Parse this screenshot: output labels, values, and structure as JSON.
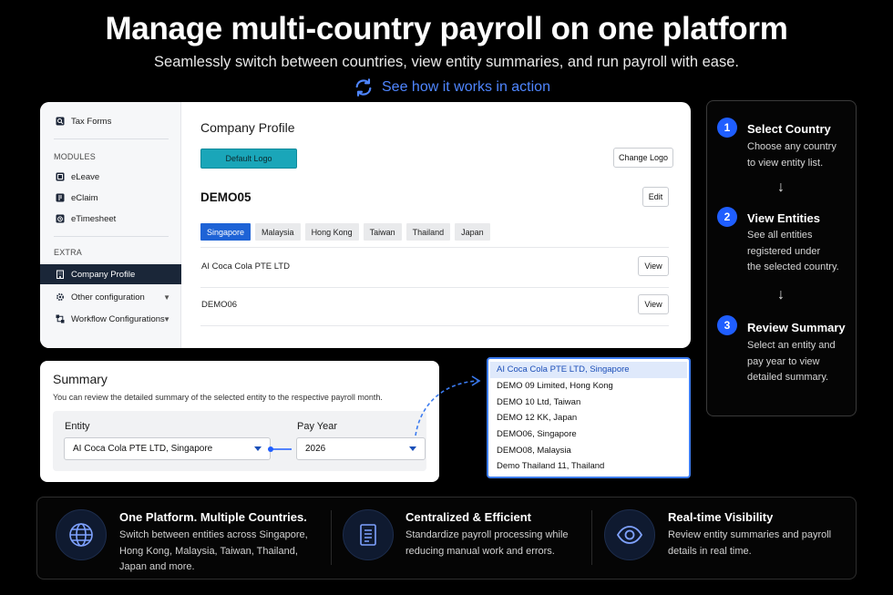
{
  "hero": {
    "title": "Manage multi-country payroll on one platform",
    "subtitle": "Seamlessly switch between countries, view entity summaries, and run payroll with ease.",
    "link_label": "See how it works in action"
  },
  "sidebar": {
    "top_item": "Tax Forms",
    "modules_header": "MODULES",
    "modules": [
      "eLeave",
      "eClaim",
      "eTimesheet"
    ],
    "extra_header": "EXTRA",
    "extra": [
      "Company Profile",
      "Other configuration",
      "Workflow Configurations"
    ],
    "active": "Company Profile"
  },
  "company_profile": {
    "title": "Company Profile",
    "default_logo_label": "Default Logo",
    "change_logo_label": "Change Logo",
    "entity_name": "DEMO05",
    "edit_label": "Edit",
    "tabs": [
      "Singapore",
      "Malaysia",
      "Hong Kong",
      "Taiwan",
      "Thailand",
      "Japan"
    ],
    "active_tab": "Singapore",
    "rows": [
      {
        "name": "AI Coca Cola PTE LTD",
        "action": "View"
      },
      {
        "name": "DEMO06",
        "action": "View"
      }
    ]
  },
  "summary": {
    "title": "Summary",
    "description": "You can review the detailed summary of the selected entity to the respective payroll month.",
    "entity_label": "Entity",
    "entity_value": "AI Coca Cola PTE LTD, Singapore",
    "year_label": "Pay Year",
    "year_value": "2026"
  },
  "entity_dropdown": {
    "options": [
      "AI Coca Cola PTE LTD, Singapore",
      "DEMO 09 Limited, Hong Kong",
      "DEMO 10 Ltd, Taiwan",
      "DEMO 12 KK, Japan",
      "DEMO06, Singapore",
      "DEMO08, Malaysia",
      "Demo Thailand 11, Thailand"
    ],
    "selected": "AI Coca Cola PTE LTD, Singapore"
  },
  "steps": [
    {
      "number": "1",
      "title": "Select Country",
      "desc_lines": [
        "Choose any country",
        "to view entity list."
      ]
    },
    {
      "number": "2",
      "title": "View Entities",
      "desc_lines": [
        "See all entities",
        "registered under",
        "the selected country."
      ]
    },
    {
      "number": "3",
      "title": "Review Summary",
      "desc_lines": [
        "Select an entity and",
        "pay year to view",
        "detailed summary."
      ]
    }
  ],
  "step_arrow": "↓",
  "features": [
    {
      "icon": "globe-icon",
      "title": "One Platform. Multiple Countries.",
      "desc_lines": [
        "Switch between entities across Singapore,",
        "Hong Kong, Malaysia, Taiwan, Thailand,",
        "Japan and more."
      ]
    },
    {
      "icon": "document-icon",
      "title": "Centralized & Efficient",
      "desc_lines": [
        "Standardize payroll processing while",
        "reducing manual work and errors."
      ]
    },
    {
      "icon": "eye-icon",
      "title": "Real-time Visibility",
      "desc_lines": [
        "Review entity summaries and payroll",
        "details in real time."
      ]
    }
  ],
  "colors": {
    "accent": "#1f5eff",
    "link": "#4f86ff",
    "teal_button": "#1aa6b9",
    "sidebar_active": "#1a2638",
    "dropdown_selected": "#dfe9fb"
  }
}
